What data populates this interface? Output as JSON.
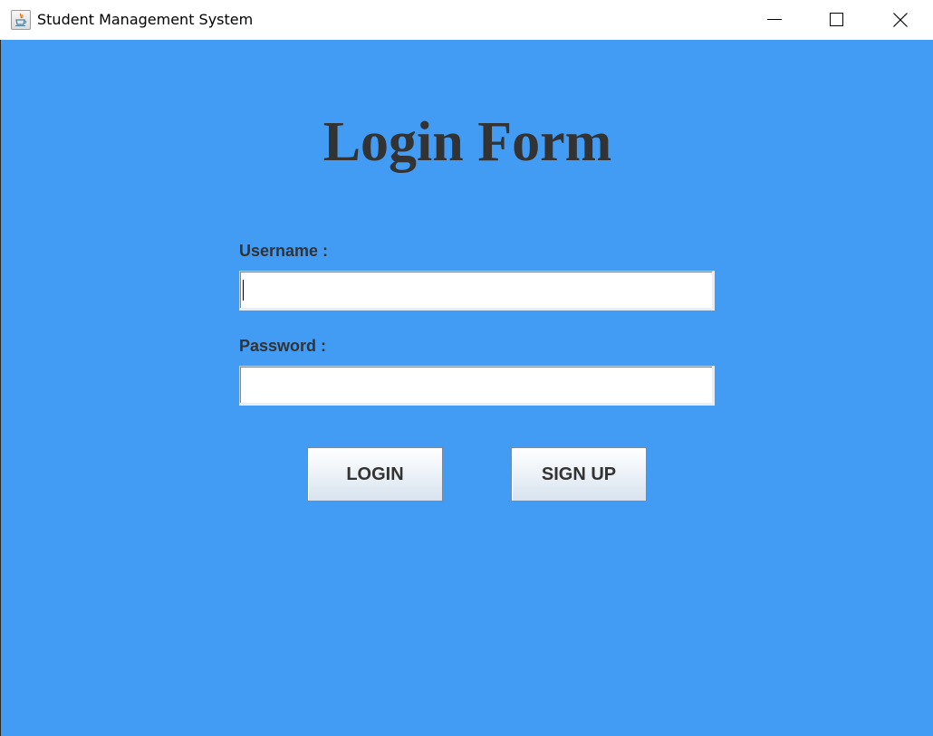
{
  "window": {
    "title": "Student Management System",
    "app_icon": "java-cup-icon",
    "controls": [
      "minimize-icon",
      "maximize-icon",
      "close-icon"
    ]
  },
  "form": {
    "heading": "Login Form",
    "username_label": "Username :",
    "username_value": "",
    "password_label": "Password :",
    "password_value": "",
    "login_label": "LOGIN",
    "signup_label": "SIGN UP"
  },
  "colors": {
    "background": "#439cf4",
    "text": "#333333"
  }
}
